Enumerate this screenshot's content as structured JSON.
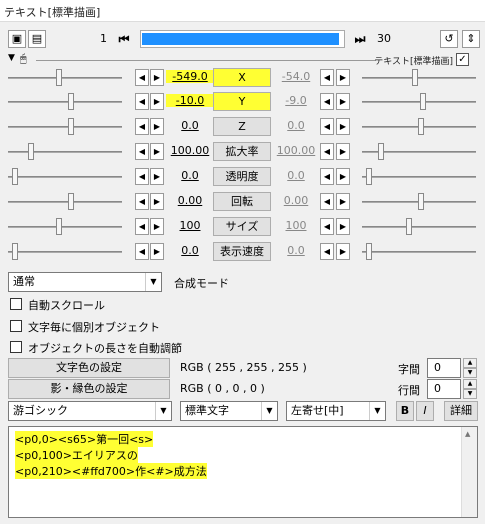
{
  "window": {
    "title": "テキスト[標準描画]"
  },
  "toolbar": {
    "frame_start": "1",
    "frame_end": "30",
    "progress_fraction": 0.98
  },
  "object": {
    "name": "テキスト[標準描画]",
    "enabled_mark": "✓"
  },
  "tracks": [
    {
      "start": "-549.0",
      "label": "X",
      "end": "-54.0",
      "highlight": true
    },
    {
      "start": "-10.0",
      "label": "Y",
      "end": "-9.0",
      "highlight": true
    },
    {
      "start": "0.0",
      "label": "Z",
      "end": "0.0",
      "highlight": false
    },
    {
      "start": "100.00",
      "label": "拡大率",
      "end": "100.00",
      "highlight": false
    },
    {
      "start": "0.0",
      "label": "透明度",
      "end": "0.0",
      "highlight": false
    },
    {
      "start": "0.00",
      "label": "回転",
      "end": "0.00",
      "highlight": false
    },
    {
      "start": "100",
      "label": "サイズ",
      "end": "100",
      "highlight": false
    },
    {
      "start": "0.0",
      "label": "表示速度",
      "end": "0.0",
      "highlight": false
    }
  ],
  "blend": {
    "value": "通常",
    "label": "合成モード"
  },
  "checkboxes": [
    {
      "label": "自動スクロール"
    },
    {
      "label": "文字毎に個別オブジェクト"
    },
    {
      "label": "オブジェクトの長さを自動調節"
    }
  ],
  "color": {
    "text_button": "文字色の設定",
    "text_rgb": "RGB ( 255 , 255 , 255 )",
    "shadow_button": "影・縁色の設定",
    "shadow_rgb": "RGB ( 0 , 0 , 0 )"
  },
  "spacing": {
    "char_label": "字間",
    "char_value": "0",
    "line_label": "行間",
    "line_value": "0"
  },
  "font": {
    "family": "游ゴシック",
    "style": "標準文字",
    "align": "左寄せ[中]",
    "bold": "B",
    "italic": "I",
    "detail": "詳細"
  },
  "text_lines": [
    "<p0,0><s65>第一回<s>",
    "<p0,100>エイリアスの",
    "<p0,210><#ffd700>作<#>成方法"
  ]
}
